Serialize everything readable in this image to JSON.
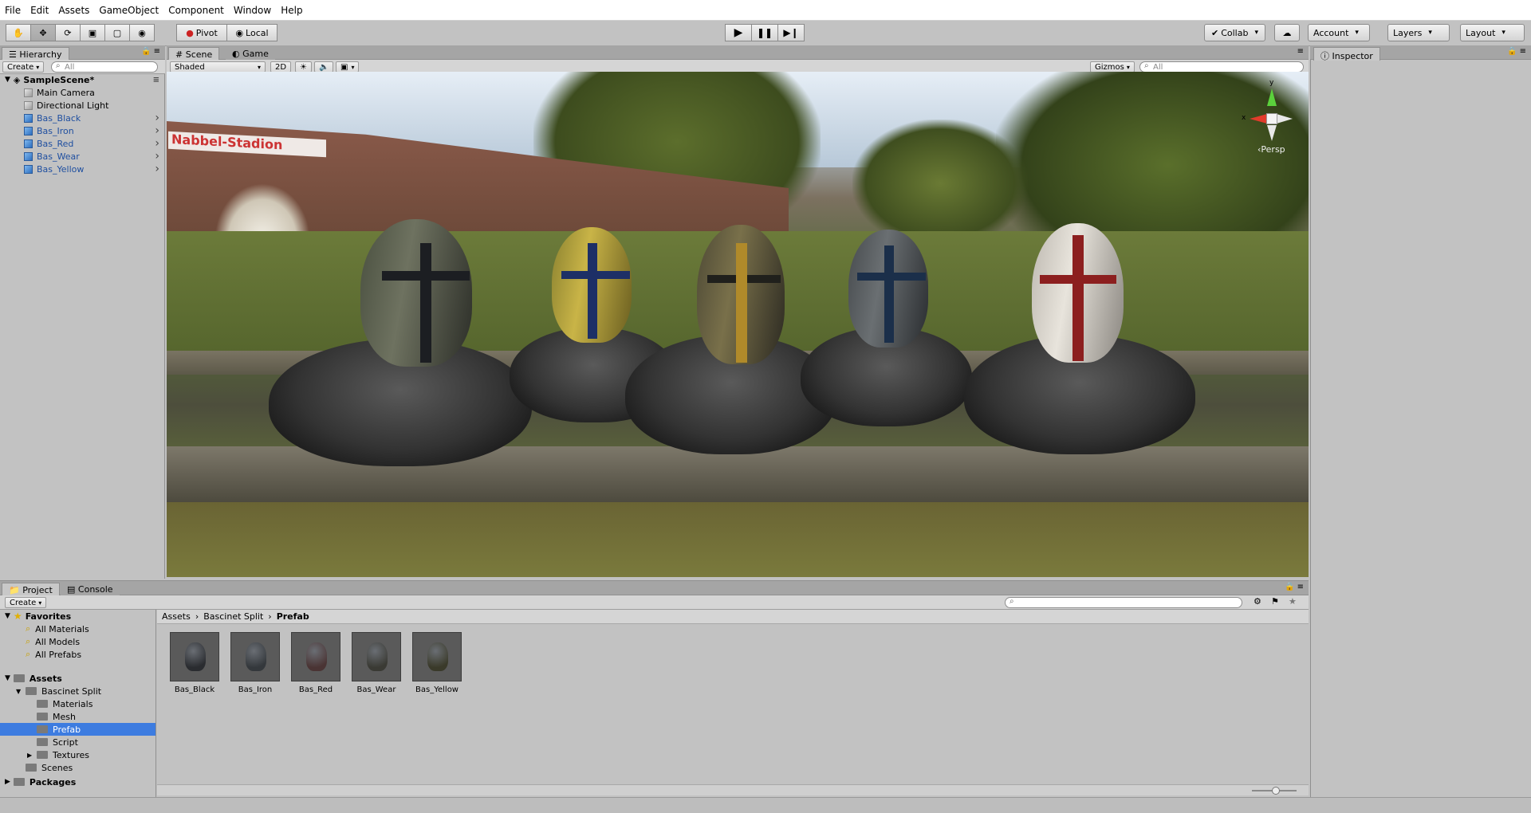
{
  "menu": [
    "File",
    "Edit",
    "Assets",
    "GameObject",
    "Component",
    "Window",
    "Help"
  ],
  "toolbar": {
    "tools": [
      "hand-icon",
      "move-icon",
      "rotate-icon",
      "scale-icon",
      "rect-icon",
      "transform-icon"
    ],
    "pivot_label": "Pivot",
    "local_label": "Local",
    "collab_label": "Collab",
    "account_label": "Account",
    "layers_label": "Layers",
    "layout_label": "Layout"
  },
  "hierarchy": {
    "tab_label": "Hierarchy",
    "create_label": "Create",
    "search_placeholder": "All",
    "scene_name": "SampleScene*",
    "items": [
      {
        "label": "Main Camera",
        "type": "gameobject"
      },
      {
        "label": "Directional Light",
        "type": "gameobject"
      },
      {
        "label": "Bas_Black",
        "type": "prefab"
      },
      {
        "label": "Bas_Iron",
        "type": "prefab"
      },
      {
        "label": "Bas_Red",
        "type": "prefab"
      },
      {
        "label": "Bas_Wear",
        "type": "prefab"
      },
      {
        "label": "Bas_Yellow",
        "type": "prefab"
      }
    ]
  },
  "scene_view": {
    "tabs": [
      "Scene",
      "Game"
    ],
    "shading_mode": "Shaded",
    "mode_2d": "2D",
    "gizmos_label": "Gizmos",
    "search_placeholder": "All",
    "projection_label": "Persp",
    "gizmo_axes": [
      "y",
      "x"
    ],
    "banner_text": "Nabbel-Stadion"
  },
  "inspector": {
    "tab_label": "Inspector"
  },
  "project": {
    "tabs": [
      "Project",
      "Console"
    ],
    "create_label": "Create",
    "favorites_label": "Favorites",
    "favorites": [
      "All Materials",
      "All Models",
      "All Prefabs"
    ],
    "assets_label": "Assets",
    "tree": [
      {
        "label": "Bascinet Split",
        "level": 1
      },
      {
        "label": "Materials",
        "level": 2
      },
      {
        "label": "Mesh",
        "level": 2
      },
      {
        "label": "Prefab",
        "level": 2,
        "selected": true
      },
      {
        "label": "Script",
        "level": 2
      },
      {
        "label": "Textures",
        "level": 2
      },
      {
        "label": "Scenes",
        "level": 1
      }
    ],
    "packages_label": "Packages",
    "breadcrumb": [
      "Assets",
      "Bascinet Split",
      "Prefab"
    ],
    "assets": [
      "Bas_Black",
      "Bas_Iron",
      "Bas_Red",
      "Bas_Wear",
      "Bas_Yellow"
    ]
  },
  "colors": {
    "selection": "#3d7ce0",
    "prefab_text": "#1f4fa0",
    "panel_bg": "#c2c2c2"
  }
}
